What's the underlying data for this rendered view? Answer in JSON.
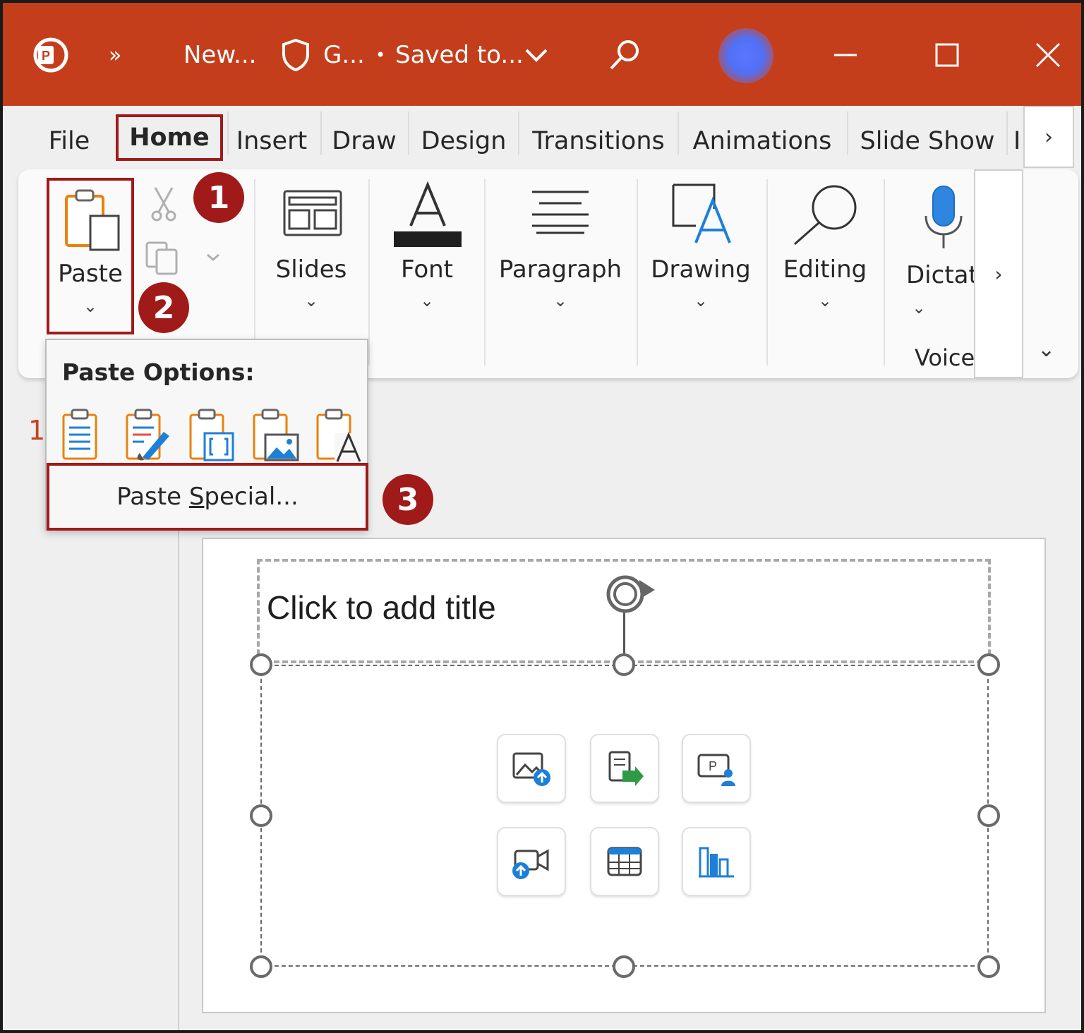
{
  "titlebar": {
    "more_label": "»",
    "filename": "New...",
    "sensitivity_label": "G...",
    "dot": "•",
    "save_status": "Saved to...",
    "chevron": "⌄",
    "minimize_glyph": "—",
    "close_glyph": "✕"
  },
  "tabs": {
    "file": "File",
    "home": "Home",
    "insert": "Insert",
    "draw": "Draw",
    "design": "Design",
    "transitions": "Transitions",
    "animations": "Animations",
    "slide_show": "Slide Show",
    "partial": "I",
    "scroll_glyph": "›"
  },
  "ribbon": {
    "paste": "Paste",
    "slides": "Slides",
    "font": "Font",
    "paragraph": "Paragraph",
    "drawing": "Drawing",
    "editing": "Editing",
    "dictate": "Dictat",
    "voice_group": "Voice",
    "chevron": "⌄",
    "scroll_glyph": "›",
    "collapse_glyph": "⌄"
  },
  "badges": {
    "one": "1",
    "two": "2",
    "three": "3"
  },
  "dropdown": {
    "title": "Paste Options:",
    "paste_special_pre": "Paste ",
    "paste_special_key": "S",
    "paste_special_post": "pecial..."
  },
  "thumbnails": {
    "slide_number": "1"
  },
  "slide": {
    "title_placeholder": "Click to add title"
  },
  "colors": {
    "titlebar": "#c43e1c",
    "highlight": "#a01a1a",
    "accent_blue": "#1e7fd8",
    "accent_orange": "#e8820c"
  }
}
